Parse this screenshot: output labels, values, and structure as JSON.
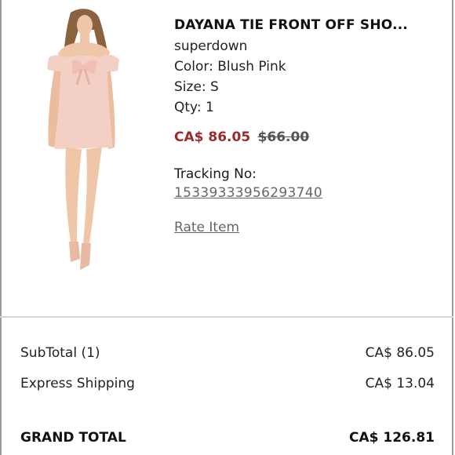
{
  "product": {
    "title": "DAYANA TIE FRONT OFF SHO...",
    "brand": "superdown",
    "color": "Color: Blush Pink",
    "size": "Size: S",
    "qty": "Qty: 1",
    "price_current": "CA$ 86.05",
    "price_original": "$66.00",
    "tracking_label": "Tracking No:",
    "tracking_number": "15339333956293740",
    "rate_item": "Rate Item"
  },
  "summary": {
    "subtotal_label": "SubTotal (1)",
    "subtotal_value": "CA$ 86.05",
    "shipping_label": "Express Shipping",
    "shipping_value": "CA$ 13.04",
    "grand_label": "GRAND TOTAL",
    "grand_value": "CA$ 126.81"
  },
  "colors": {
    "price_accent": "#9b2b2b",
    "dress": "#f4cfc4",
    "skin": "#f0c6a8",
    "hair": "#8a6240"
  }
}
